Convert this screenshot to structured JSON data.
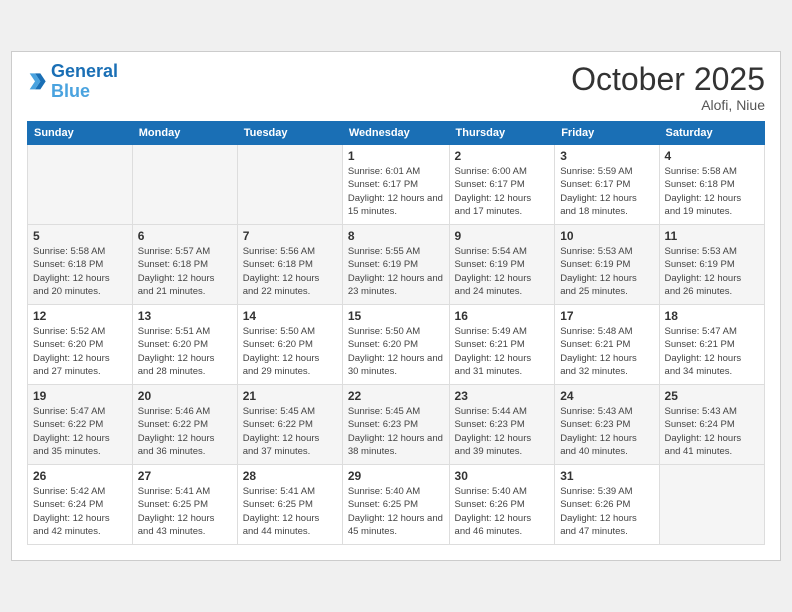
{
  "header": {
    "logo_line1": "General",
    "logo_line2": "Blue",
    "month": "October 2025",
    "location": "Alofi, Niue"
  },
  "weekdays": [
    "Sunday",
    "Monday",
    "Tuesday",
    "Wednesday",
    "Thursday",
    "Friday",
    "Saturday"
  ],
  "weeks": [
    [
      {
        "day": "",
        "info": ""
      },
      {
        "day": "",
        "info": ""
      },
      {
        "day": "",
        "info": ""
      },
      {
        "day": "1",
        "info": "Sunrise: 6:01 AM\nSunset: 6:17 PM\nDaylight: 12 hours\nand 15 minutes."
      },
      {
        "day": "2",
        "info": "Sunrise: 6:00 AM\nSunset: 6:17 PM\nDaylight: 12 hours\nand 17 minutes."
      },
      {
        "day": "3",
        "info": "Sunrise: 5:59 AM\nSunset: 6:17 PM\nDaylight: 12 hours\nand 18 minutes."
      },
      {
        "day": "4",
        "info": "Sunrise: 5:58 AM\nSunset: 6:18 PM\nDaylight: 12 hours\nand 19 minutes."
      }
    ],
    [
      {
        "day": "5",
        "info": "Sunrise: 5:58 AM\nSunset: 6:18 PM\nDaylight: 12 hours\nand 20 minutes."
      },
      {
        "day": "6",
        "info": "Sunrise: 5:57 AM\nSunset: 6:18 PM\nDaylight: 12 hours\nand 21 minutes."
      },
      {
        "day": "7",
        "info": "Sunrise: 5:56 AM\nSunset: 6:18 PM\nDaylight: 12 hours\nand 22 minutes."
      },
      {
        "day": "8",
        "info": "Sunrise: 5:55 AM\nSunset: 6:19 PM\nDaylight: 12 hours\nand 23 minutes."
      },
      {
        "day": "9",
        "info": "Sunrise: 5:54 AM\nSunset: 6:19 PM\nDaylight: 12 hours\nand 24 minutes."
      },
      {
        "day": "10",
        "info": "Sunrise: 5:53 AM\nSunset: 6:19 PM\nDaylight: 12 hours\nand 25 minutes."
      },
      {
        "day": "11",
        "info": "Sunrise: 5:53 AM\nSunset: 6:19 PM\nDaylight: 12 hours\nand 26 minutes."
      }
    ],
    [
      {
        "day": "12",
        "info": "Sunrise: 5:52 AM\nSunset: 6:20 PM\nDaylight: 12 hours\nand 27 minutes."
      },
      {
        "day": "13",
        "info": "Sunrise: 5:51 AM\nSunset: 6:20 PM\nDaylight: 12 hours\nand 28 minutes."
      },
      {
        "day": "14",
        "info": "Sunrise: 5:50 AM\nSunset: 6:20 PM\nDaylight: 12 hours\nand 29 minutes."
      },
      {
        "day": "15",
        "info": "Sunrise: 5:50 AM\nSunset: 6:20 PM\nDaylight: 12 hours\nand 30 minutes."
      },
      {
        "day": "16",
        "info": "Sunrise: 5:49 AM\nSunset: 6:21 PM\nDaylight: 12 hours\nand 31 minutes."
      },
      {
        "day": "17",
        "info": "Sunrise: 5:48 AM\nSunset: 6:21 PM\nDaylight: 12 hours\nand 32 minutes."
      },
      {
        "day": "18",
        "info": "Sunrise: 5:47 AM\nSunset: 6:21 PM\nDaylight: 12 hours\nand 34 minutes."
      }
    ],
    [
      {
        "day": "19",
        "info": "Sunrise: 5:47 AM\nSunset: 6:22 PM\nDaylight: 12 hours\nand 35 minutes."
      },
      {
        "day": "20",
        "info": "Sunrise: 5:46 AM\nSunset: 6:22 PM\nDaylight: 12 hours\nand 36 minutes."
      },
      {
        "day": "21",
        "info": "Sunrise: 5:45 AM\nSunset: 6:22 PM\nDaylight: 12 hours\nand 37 minutes."
      },
      {
        "day": "22",
        "info": "Sunrise: 5:45 AM\nSunset: 6:23 PM\nDaylight: 12 hours\nand 38 minutes."
      },
      {
        "day": "23",
        "info": "Sunrise: 5:44 AM\nSunset: 6:23 PM\nDaylight: 12 hours\nand 39 minutes."
      },
      {
        "day": "24",
        "info": "Sunrise: 5:43 AM\nSunset: 6:23 PM\nDaylight: 12 hours\nand 40 minutes."
      },
      {
        "day": "25",
        "info": "Sunrise: 5:43 AM\nSunset: 6:24 PM\nDaylight: 12 hours\nand 41 minutes."
      }
    ],
    [
      {
        "day": "26",
        "info": "Sunrise: 5:42 AM\nSunset: 6:24 PM\nDaylight: 12 hours\nand 42 minutes."
      },
      {
        "day": "27",
        "info": "Sunrise: 5:41 AM\nSunset: 6:25 PM\nDaylight: 12 hours\nand 43 minutes."
      },
      {
        "day": "28",
        "info": "Sunrise: 5:41 AM\nSunset: 6:25 PM\nDaylight: 12 hours\nand 44 minutes."
      },
      {
        "day": "29",
        "info": "Sunrise: 5:40 AM\nSunset: 6:25 PM\nDaylight: 12 hours\nand 45 minutes."
      },
      {
        "day": "30",
        "info": "Sunrise: 5:40 AM\nSunset: 6:26 PM\nDaylight: 12 hours\nand 46 minutes."
      },
      {
        "day": "31",
        "info": "Sunrise: 5:39 AM\nSunset: 6:26 PM\nDaylight: 12 hours\nand 47 minutes."
      },
      {
        "day": "",
        "info": ""
      }
    ]
  ]
}
